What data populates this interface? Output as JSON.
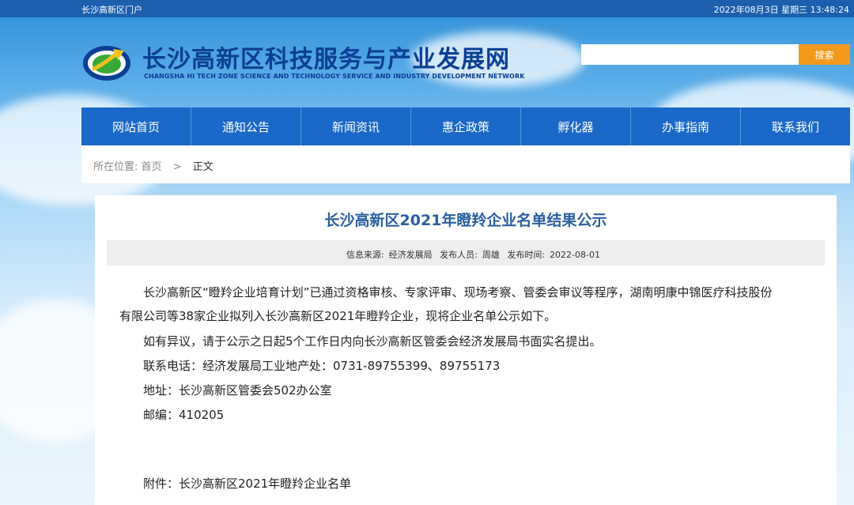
{
  "topbar": {
    "portal": "长沙高新区门户",
    "datetime": "2022年08月3日 星期三 13:48:24"
  },
  "header": {
    "title": "长沙高新区科技服务与产业发展网",
    "subtitle": "CHANGSHA HI TECH ZONE SCIENCE AND TECHNOLOGY SERVICE AND INDUSTRY DEVELOPMENT NETWORK",
    "logo_icon": "globe-arrow-logo",
    "search_value": "",
    "search_button": "搜索",
    "accent": "#1a68c8",
    "search_color": "#f39a1c"
  },
  "nav": {
    "items": [
      {
        "label": "网站首页"
      },
      {
        "label": "通知公告"
      },
      {
        "label": "新闻资讯"
      },
      {
        "label": "惠企政策"
      },
      {
        "label": "孵化器"
      },
      {
        "label": "办事指南"
      },
      {
        "label": "联系我们"
      }
    ]
  },
  "breadcrumb": {
    "prefix": "所在位置:",
    "home": "首页",
    "sep": ">",
    "current": "正文"
  },
  "article": {
    "title": "长沙高新区2021年瞪羚企业名单结果公示",
    "meta": {
      "source_label": "信息来源:",
      "source": "经济发展局",
      "author_label": "发布人员:",
      "author": "周雄",
      "time_label": "发布时间:",
      "time": "2022-08-01"
    },
    "para1_line1": "长沙高新区“瞪羚企业培育计划”已通过资格审核、专家评审、现场考察、管委会审议等程序，湖南明康中锦医疗科技股份",
    "para1_line2": "有限公司等38家企业拟列入长沙高新区2021年瞪羚企业，现将企业名单公示如下。",
    "para2": "如有异议，请于公示之日起5个工作日内向长沙高新区管委会经济发展局书面实名提出。",
    "contact": "联系电话：经济发展局工业地产处：0731-89755399、89755173",
    "address": "地址：长沙高新区管委会502办公室",
    "postcode": "邮编：410205",
    "attachment": "附件：长沙高新区2021年瞪羚企业名单"
  }
}
